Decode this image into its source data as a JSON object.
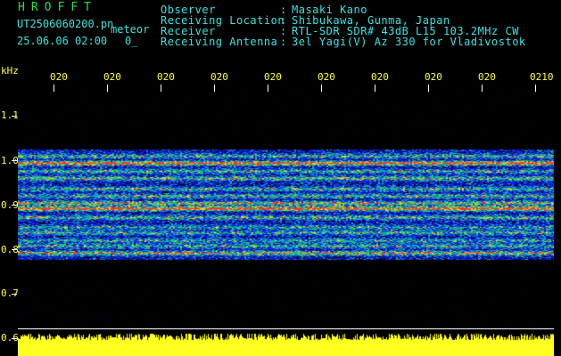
{
  "header": {
    "title": "HROFFT",
    "filename": "UT2506060200.pn",
    "tag": "meteor",
    "datetime": "25.06.06 02:00",
    "counter": "0_"
  },
  "info": {
    "labels": [
      "Observer",
      "Receiving Location",
      "Receiver",
      "Receiving Antenna"
    ],
    "colons": [
      ":",
      ":",
      ":",
      ":"
    ],
    "values": [
      "Masaki Kano",
      "Shibukawa, Gunma, Japan",
      "RTL-SDR SDR# 43dB L15 103.2MHz CW",
      "3el Yagi(V) Az 330 for Vladivostok"
    ]
  },
  "axes": {
    "y_unit": "kHz",
    "y_ticks": [
      "1.1",
      "1.0",
      "0.9",
      "0.8",
      "0.7",
      "0.6"
    ],
    "x_ticks": [
      "020",
      "020",
      "020",
      "020",
      "020",
      "020",
      "020",
      "020",
      "020",
      "0210"
    ]
  },
  "colors": {
    "background": "#000000",
    "header_cyan": "#40e0e0",
    "title_green": "#20e040",
    "noise_blue": "#1020c0",
    "band_red": "#ff3030",
    "power_yellow": "#ffff20"
  },
  "spectrogram": {
    "band_ticks_khz": [
      1.0,
      0.9,
      0.8
    ],
    "freq_range_khz": [
      0.6,
      1.2
    ]
  }
}
